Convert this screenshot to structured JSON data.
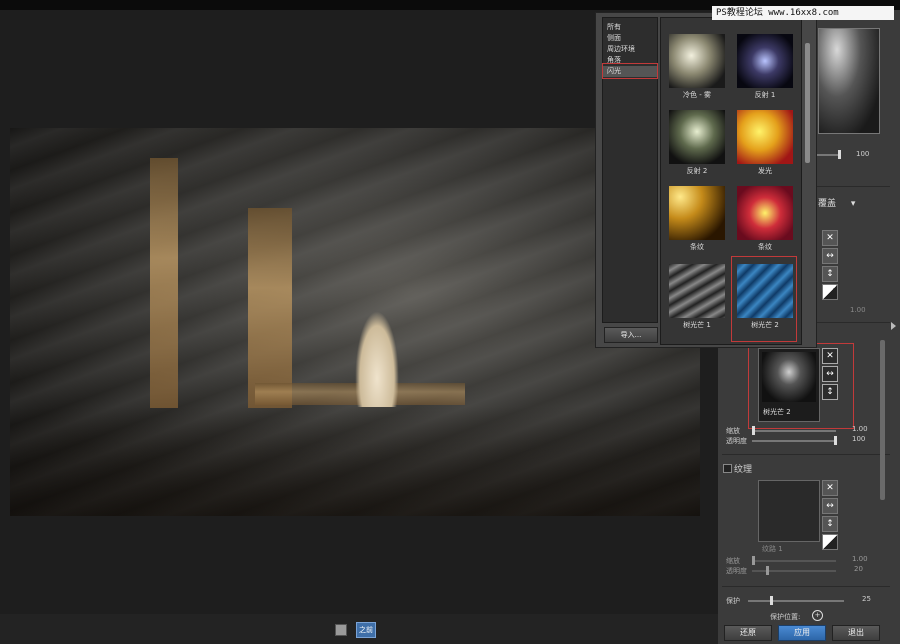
{
  "watermark": "PS教程论坛 www.16xx8.com",
  "bottom_bar": {
    "view_button": "之前"
  },
  "popup": {
    "categories": [
      "所有",
      "侧面",
      "周边环境",
      "角落",
      "闪光"
    ],
    "selected_category": "闪光",
    "import_label": "导入...",
    "thumbnails": [
      {
        "label": "冷色 - 雾",
        "style": "fog-icon"
      },
      {
        "label": "反射 1",
        "style": "reflect-icon"
      },
      {
        "label": "反射 2",
        "style": "reflect2-icon"
      },
      {
        "label": "发光",
        "style": "glow-icon"
      },
      {
        "label": "条纹",
        "style": "stripe-gold-icon"
      },
      {
        "label": "条纹",
        "style": "stripe-red-icon"
      },
      {
        "label": "树光芒 1",
        "style": "rays1-icon"
      },
      {
        "label": "树光芒 2",
        "style": "rays2-icon"
      }
    ],
    "selected_thumbnail": "树光芒 2"
  },
  "right_panel": {
    "top_value": "100",
    "blend_mode": "覆盖",
    "mid_value": "1.00",
    "flare_caption": "树光芒 2",
    "scale_label": "缩放",
    "scale_value": "1.00",
    "opacity_label": "透明度",
    "opacity_value": "100",
    "texture_label": "纹理",
    "texture_caption": "纹路 1",
    "tex_scale_label": "缩放",
    "tex_scale_value": "1.00",
    "tex_opacity_label": "透明度",
    "tex_opacity_value": "20",
    "protect_label": "保护",
    "protect_value": "25",
    "protect_pos_label": "保护位置:",
    "buttons": {
      "reset": "还原",
      "apply": "应用",
      "exit": "退出"
    }
  },
  "colors": {
    "accent": "#2d66a8",
    "highlight_border": "#c23a3a",
    "panel_bg": "#3b3b3b"
  }
}
